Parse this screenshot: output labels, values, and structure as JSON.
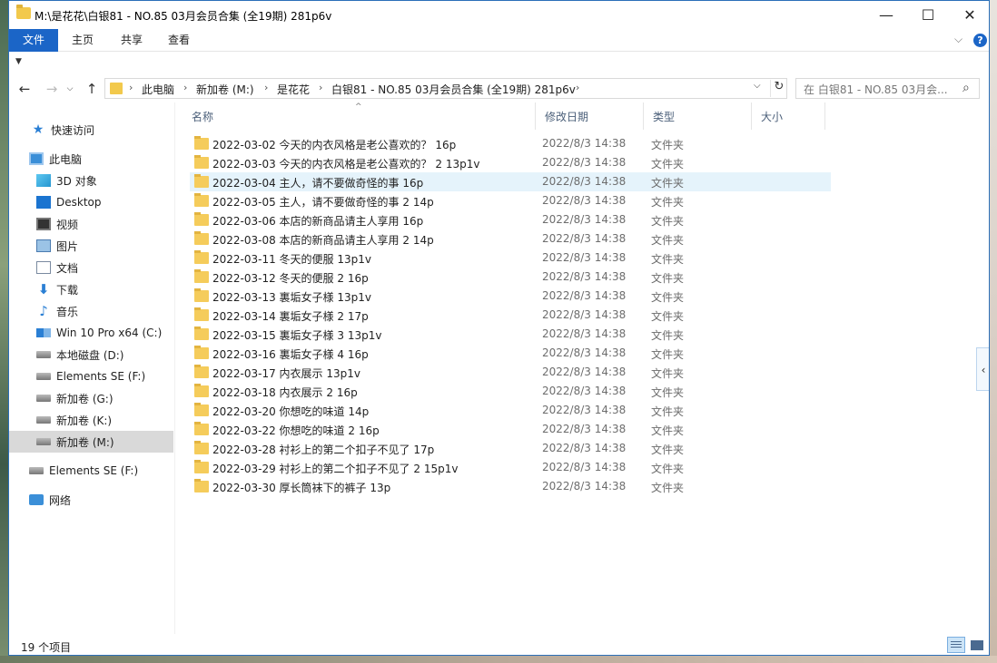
{
  "window": {
    "title": "M:\\是花花\\白银81 - NO.85 03月会员合集 (全19期) 281p6v",
    "minimize": "—",
    "maximize": "☐",
    "close": "✕"
  },
  "ribbon": {
    "tabs": [
      "文件",
      "主页",
      "共享",
      "查看"
    ],
    "chevron": "⌵",
    "help": "?"
  },
  "navbar": {
    "back": "←",
    "forward": "→",
    "recent": "⌵",
    "up": "↑",
    "breadcrumbs": [
      "此电脑",
      "新加卷 (M:)",
      "是花花",
      "白银81 - NO.85 03月会员合集 (全19期) 281p6v"
    ],
    "separator": "›",
    "dropdown": "⌵",
    "refresh": "↻",
    "search_placeholder": "在 白银81 - NO.85 03月会...",
    "search_icon": "search-icon"
  },
  "sidebar": {
    "items": [
      {
        "label": "快速访问",
        "icon": "star-icon"
      },
      {
        "label": "此电脑",
        "icon": "computer-icon"
      },
      {
        "label": "3D 对象",
        "icon": "cube-icon"
      },
      {
        "label": "Desktop",
        "icon": "desktop-icon"
      },
      {
        "label": "视频",
        "icon": "video-icon"
      },
      {
        "label": "图片",
        "icon": "pictures-icon"
      },
      {
        "label": "文档",
        "icon": "documents-icon"
      },
      {
        "label": "下载",
        "icon": "download-icon"
      },
      {
        "label": "音乐",
        "icon": "music-icon"
      },
      {
        "label": "Win 10 Pro x64 (C:)",
        "icon": "windows-drive-icon"
      },
      {
        "label": "本地磁盘 (D:)",
        "icon": "drive-icon"
      },
      {
        "label": "Elements SE (F:)",
        "icon": "drive-icon"
      },
      {
        "label": "新加卷 (G:)",
        "icon": "drive-icon"
      },
      {
        "label": "新加卷 (K:)",
        "icon": "drive-icon"
      },
      {
        "label": "新加卷 (M:)",
        "icon": "drive-icon"
      },
      {
        "label": "Elements SE (F:)",
        "icon": "drive-icon"
      },
      {
        "label": "网络",
        "icon": "network-icon"
      }
    ],
    "selected": "新加卷 (M:)"
  },
  "columns": {
    "name": "名称",
    "date": "修改日期",
    "type": "类型",
    "size": "大小",
    "sort_indicator": "^"
  },
  "files": [
    {
      "name": "2022-03-02 今天的内衣风格是老公喜欢的？ 16p",
      "date": "2022/8/3 14:38",
      "type": "文件夹"
    },
    {
      "name": "2022-03-03 今天的内衣风格是老公喜欢的？ 2 13p1v",
      "date": "2022/8/3 14:38",
      "type": "文件夹"
    },
    {
      "name": "2022-03-04 主人，请不要做奇怪的事 16p",
      "date": "2022/8/3 14:38",
      "type": "文件夹"
    },
    {
      "name": "2022-03-05 主人，请不要做奇怪的事 2 14p",
      "date": "2022/8/3 14:38",
      "type": "文件夹"
    },
    {
      "name": "2022-03-06 本店的新商品请主人享用 16p",
      "date": "2022/8/3 14:38",
      "type": "文件夹"
    },
    {
      "name": "2022-03-08 本店的新商品请主人享用 2 14p",
      "date": "2022/8/3 14:38",
      "type": "文件夹"
    },
    {
      "name": "2022-03-11 冬天的便服 13p1v",
      "date": "2022/8/3 14:38",
      "type": "文件夹"
    },
    {
      "name": "2022-03-12 冬天的便服 2 16p",
      "date": "2022/8/3 14:38",
      "type": "文件夹"
    },
    {
      "name": "2022-03-13 裏垢女子様 13p1v",
      "date": "2022/8/3 14:38",
      "type": "文件夹"
    },
    {
      "name": "2022-03-14 裏垢女子様 2 17p",
      "date": "2022/8/3 14:38",
      "type": "文件夹"
    },
    {
      "name": "2022-03-15 裏垢女子様 3 13p1v",
      "date": "2022/8/3 14:38",
      "type": "文件夹"
    },
    {
      "name": "2022-03-16 裏垢女子様 4 16p",
      "date": "2022/8/3 14:38",
      "type": "文件夹"
    },
    {
      "name": "2022-03-17 内衣展示 13p1v",
      "date": "2022/8/3 14:38",
      "type": "文件夹"
    },
    {
      "name": "2022-03-18 内衣展示 2 16p",
      "date": "2022/8/3 14:38",
      "type": "文件夹"
    },
    {
      "name": "2022-03-20 你想吃的味道 14p",
      "date": "2022/8/3 14:38",
      "type": "文件夹"
    },
    {
      "name": "2022-03-22 你想吃的味道 2 16p",
      "date": "2022/8/3 14:38",
      "type": "文件夹"
    },
    {
      "name": "2022-03-28 衬衫上的第二个扣子不见了 17p",
      "date": "2022/8/3 14:38",
      "type": "文件夹"
    },
    {
      "name": "2022-03-29 衬衫上的第二个扣子不见了 2 15p1v",
      "date": "2022/8/3 14:38",
      "type": "文件夹"
    },
    {
      "name": "2022-03-30 厚长筒袜下的裤子 13p",
      "date": "2022/8/3 14:38",
      "type": "文件夹"
    }
  ],
  "hovered_file": "2022-03-04 主人，请不要做奇怪的事 16p",
  "status": {
    "count_text": "19 个项目"
  },
  "side_tab": "‹",
  "colors": {
    "accent": "#1b65c7",
    "folder": "#f5cc5b",
    "hover_row": "#e5f3fb",
    "selected_nav": "#d9d9d9"
  }
}
